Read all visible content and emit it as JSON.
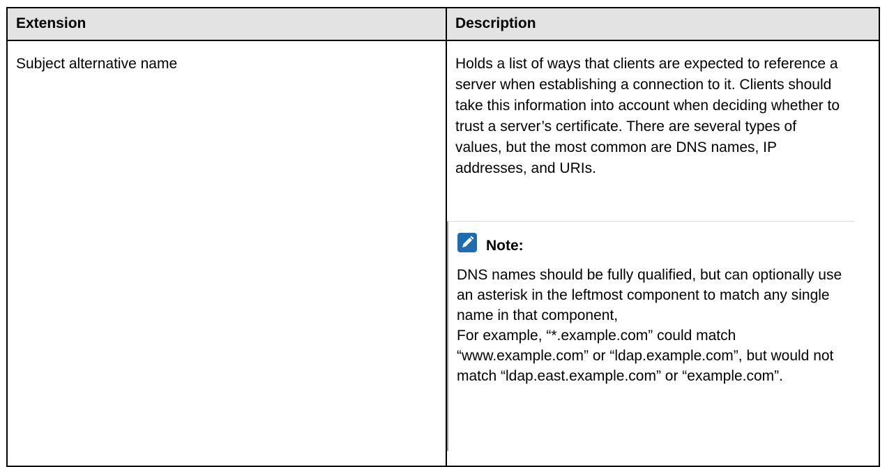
{
  "table": {
    "headers": {
      "extension": "Extension",
      "description": "Description"
    },
    "rows": [
      {
        "extension": "Subject alternative name",
        "description": "Holds a list of ways that clients are expected to reference a server when establishing a connection to it. Clients should take this information into account when deciding whether to trust a server’s certificate. There are several types of values, but the most common are DNS names, IP addresses, and URIs.",
        "note": {
          "icon": "pencil-note-icon",
          "title": "Note:",
          "body": "DNS names should be fully qualified, but can optionally use an asterisk in the leftmost component to match any single name in that component,\nFor example, “*.example.com” could match “www.example.com” or “ldap.example.com”, but would not match “ldap.east.example.com” or “example.com”."
        }
      }
    ]
  },
  "colors": {
    "header_background": "#e3e3e3",
    "note_icon": "#1f6cb0",
    "border": "#000000"
  }
}
